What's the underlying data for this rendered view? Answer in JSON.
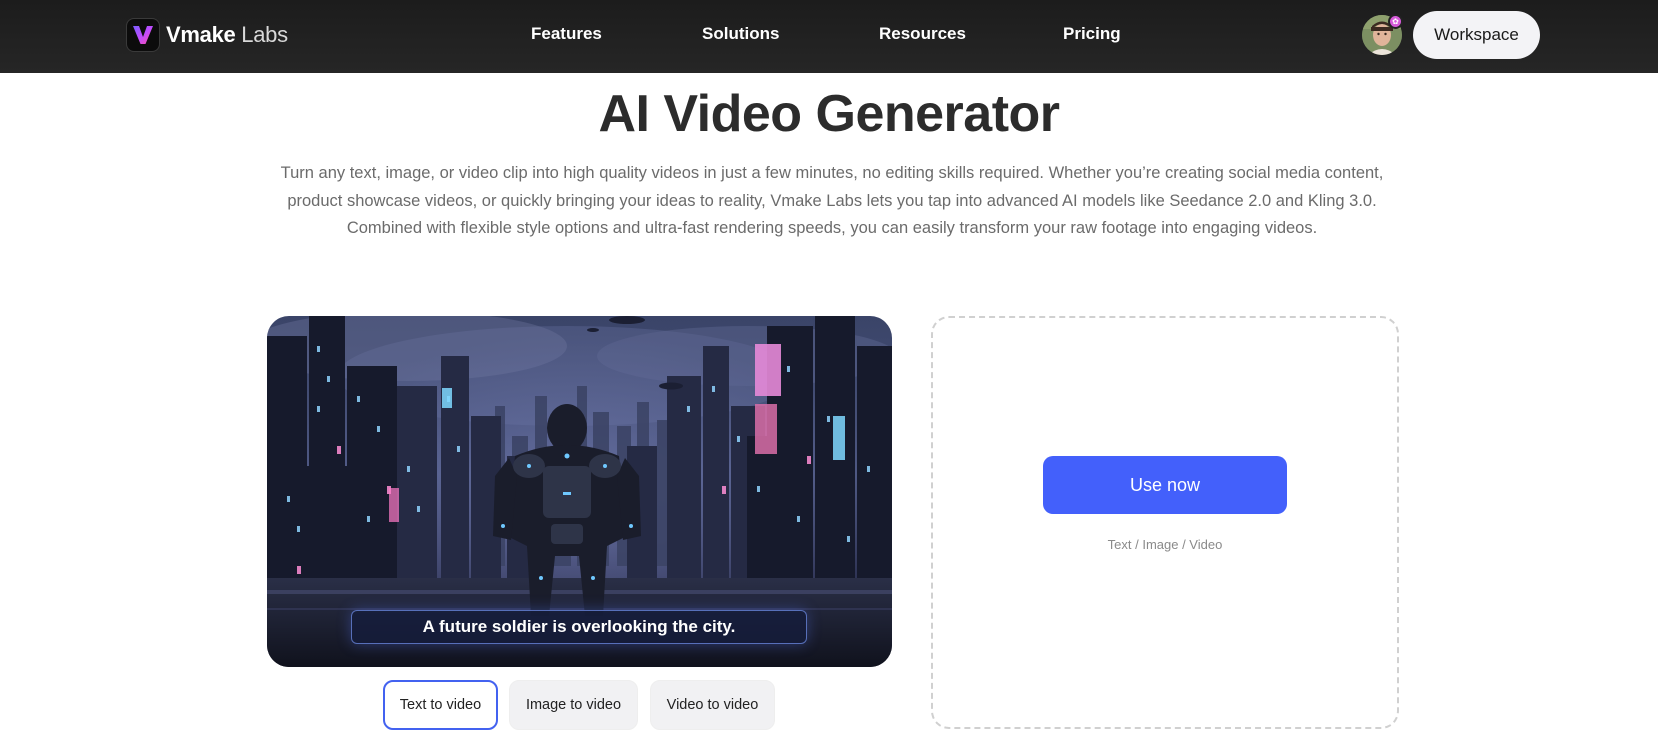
{
  "brand": {
    "name_bold": "Vmake",
    "name_light": " Labs"
  },
  "nav": {
    "items": [
      {
        "label": "Features"
      },
      {
        "label": "Solutions"
      },
      {
        "label": "Resources"
      },
      {
        "label": "Pricing"
      }
    ],
    "workspace_label": "Workspace",
    "avatar_icon": "user-avatar",
    "badge_icon": "sparkle-icon"
  },
  "hero": {
    "title": "AI Video Generator",
    "description": "Turn any text, image, or video clip into high quality videos in just a few minutes, no editing skills required. Whether you’re creating social media content, product showcase videos, or quickly bringing your ideas to reality, Vmake Labs lets you tap into advanced AI models like Seedance 2.0 and Kling 3.0. Combined with flexible style options and ultra-fast rendering speeds, you can easily transform your raw footage into engaging videos."
  },
  "preview": {
    "caption": "A future soldier is overlooking the city."
  },
  "modes": {
    "tabs": [
      {
        "label": "Text to video",
        "selected": true
      },
      {
        "label": "Image to video",
        "selected": false
      },
      {
        "label": "Video to video",
        "selected": false
      }
    ]
  },
  "upload": {
    "button_label": "Use now",
    "hint": "Text / Image / Video"
  },
  "colors": {
    "accent": "#4360fb",
    "nav_bg": "#1f1f1f",
    "selected_tab_border": "#4362f0"
  }
}
